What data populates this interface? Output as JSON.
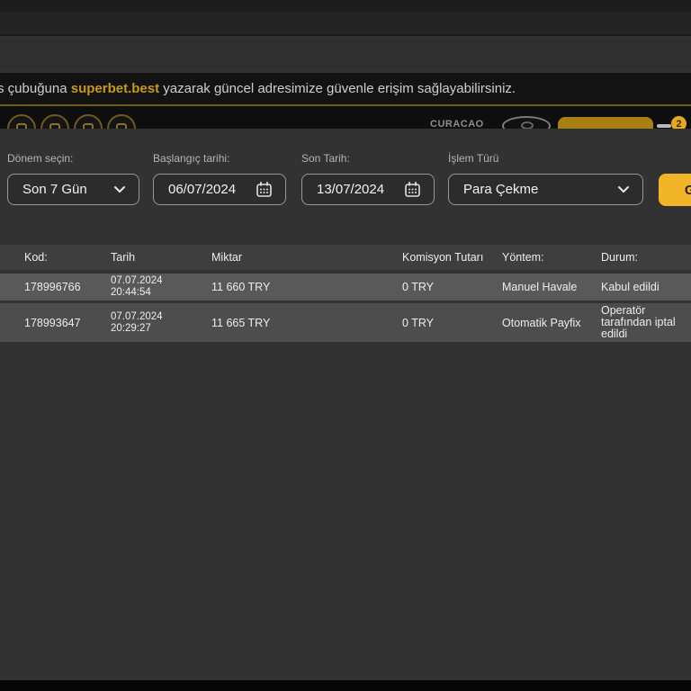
{
  "notice": {
    "prefix": "s çubuğuna ",
    "link": "superbet.best",
    "suffix": " yazarak güncel adresimize güvenle erişim sağlayabilirsiniz."
  },
  "header": {
    "license": "CURACAO",
    "badge_count": "2"
  },
  "filters": {
    "period": {
      "label": "Dönem seçin:",
      "value": "Son 7 Gün"
    },
    "start_date": {
      "label": "Başlangıç tarihi:",
      "value": "06/07/2024"
    },
    "end_date": {
      "label": "Son Tarih:",
      "value": "13/07/2024"
    },
    "tx_type": {
      "label": "İşlem Türü",
      "value": "Para Çekme"
    },
    "submit_label": "Göster"
  },
  "table": {
    "columns": [
      "Kod:",
      "Tarih",
      "Miktar",
      "Komisyon Tutarı",
      "Yöntem:",
      "Durum:"
    ],
    "rows": [
      {
        "kod": "178996766",
        "tarih": "07.07.2024\n20:44:54",
        "miktar": "11 660 TRY",
        "komisyon": "0 TRY",
        "yontem": "Manuel Havale",
        "durum": "Kabul edildi"
      },
      {
        "kod": "178993647",
        "tarih": "07.07.2024\n20:29:27",
        "miktar": "11 665 TRY",
        "komisyon": "0 TRY",
        "yontem": "Otomatik Payfix",
        "durum": "Operatör tarafından iptal edildi"
      }
    ]
  },
  "colors": {
    "accent": "#f2b52a",
    "link_gold": "#c79a1a",
    "panel": "#323232",
    "row_light": "#595959",
    "row_dark": "#4d4d4d"
  }
}
